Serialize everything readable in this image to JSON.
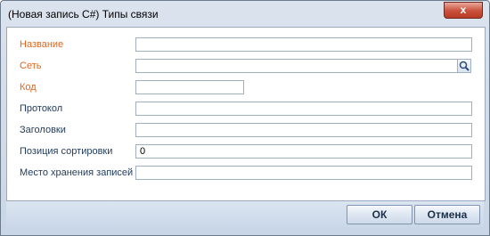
{
  "window": {
    "title": "(Новая запись C#) Типы связи",
    "close_glyph": "x"
  },
  "form": {
    "fields": [
      {
        "label": "Название",
        "value": "",
        "required": true
      },
      {
        "label": "Сеть",
        "value": "",
        "required": true,
        "lookup_icon": "search-icon"
      },
      {
        "label": "Код",
        "value": "",
        "required": true
      },
      {
        "label": "Протокол",
        "value": "",
        "required": false
      },
      {
        "label": "Заголовки",
        "value": "",
        "required": false
      },
      {
        "label": "Позиция сортировки",
        "value": "0",
        "required": false
      },
      {
        "label": "Место хранения записей",
        "value": "",
        "required": false
      }
    ]
  },
  "buttons": {
    "ok": "ОК",
    "cancel": "Отмена"
  },
  "colors": {
    "required_label": "#e0651a",
    "label": "#1f3a5a",
    "accent": "#c9503a"
  }
}
